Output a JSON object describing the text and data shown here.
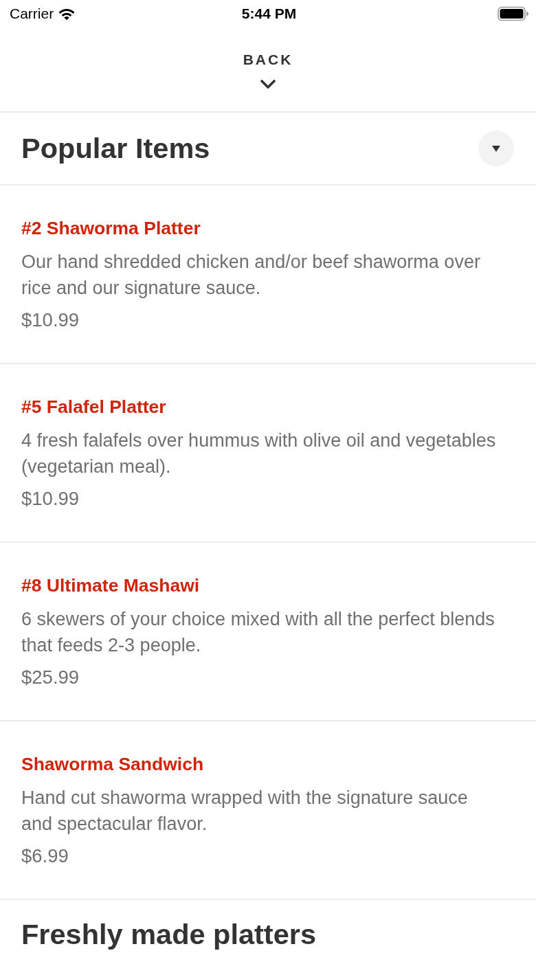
{
  "status_bar": {
    "carrier": "Carrier",
    "time": "5:44 PM"
  },
  "header": {
    "back_label": "BACK"
  },
  "sections": [
    {
      "title": "Popular Items",
      "toggle": true,
      "items": [
        {
          "name": "#2 Shaworma Platter",
          "description": "Our hand shredded chicken and/or beef shaworma over rice and our signature sauce.",
          "price": "$10.99"
        },
        {
          "name": "#5 Falafel Platter",
          "description": "4 fresh falafels over hummus with olive oil and vegetables (vegetarian meal).",
          "price": "$10.99"
        },
        {
          "name": "#8 Ultimate Mashawi",
          "description": "6 skewers of your choice mixed with all the perfect blends that feeds 2-3 people.",
          "price": "$25.99"
        },
        {
          "name": "Shaworma Sandwich",
          "description": "Hand cut shaworma wrapped with the signature sauce and spectacular flavor.",
          "price": "$6.99"
        }
      ]
    },
    {
      "title": "Freshly made platters"
    }
  ]
}
